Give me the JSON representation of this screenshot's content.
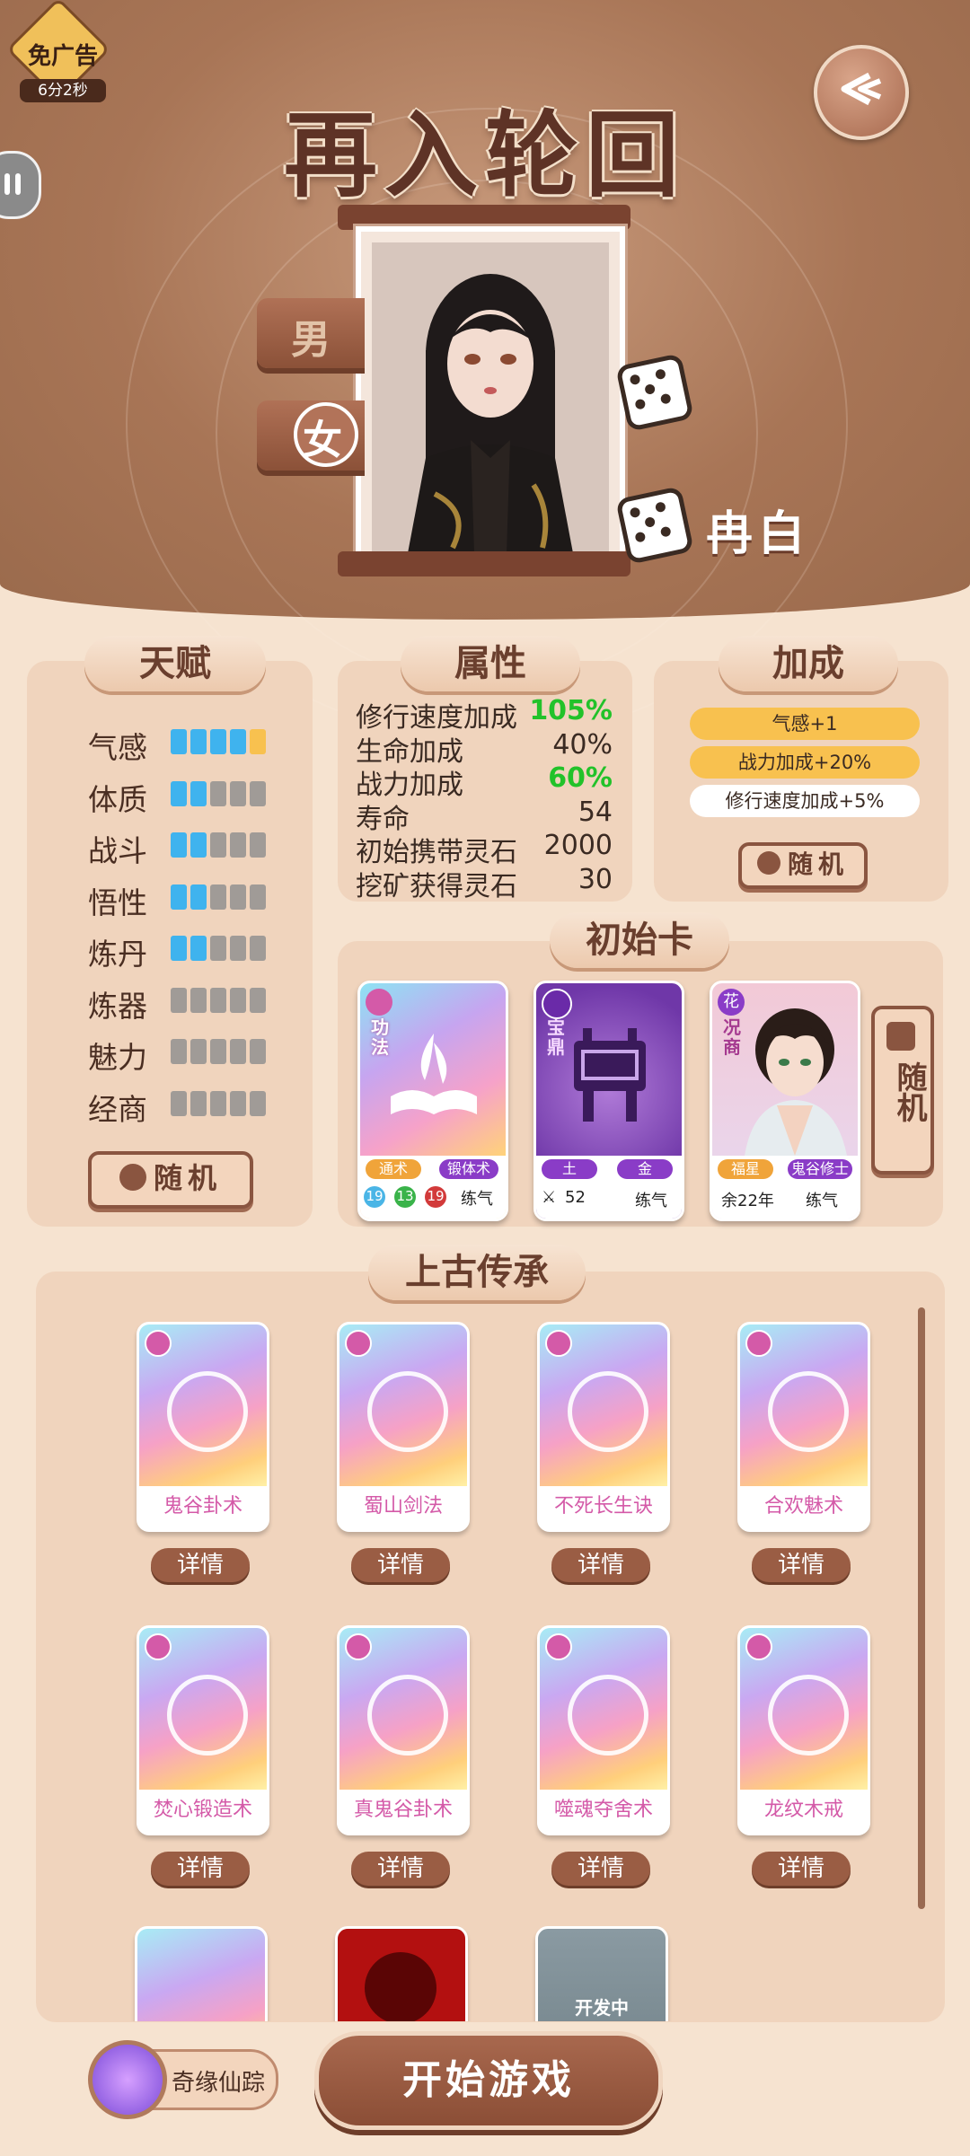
{
  "header": {
    "title": "再入轮回",
    "ad_label": "免广告",
    "ad_timer": "6分2秒"
  },
  "character": {
    "male": "男",
    "female": "女",
    "name": "冉白"
  },
  "talent": {
    "title": "天赋",
    "rows": [
      {
        "label": "气感",
        "level": 5
      },
      {
        "label": "体质",
        "level": 2
      },
      {
        "label": "战斗",
        "level": 2
      },
      {
        "label": "悟性",
        "level": 2
      },
      {
        "label": "炼丹",
        "level": 2
      },
      {
        "label": "炼器",
        "level": 0
      },
      {
        "label": "魅力",
        "level": 0
      },
      {
        "label": "经商",
        "level": 0
      }
    ],
    "random": "随机"
  },
  "attributes": {
    "title": "属性",
    "rows": [
      {
        "label": "修行速度加成",
        "value": "105%",
        "color": "#22c22a"
      },
      {
        "label": "生命加成",
        "value": "40%",
        "color": "#3a2a22"
      },
      {
        "label": "战力加成",
        "value": "60%",
        "color": "#22c22a"
      },
      {
        "label": "寿命",
        "value": "54",
        "color": "#3a2a22"
      },
      {
        "label": "初始携带灵石",
        "value": "2000",
        "color": "#3a2a22"
      },
      {
        "label": "挖矿获得灵石",
        "value": "30",
        "color": "#3a2a22"
      }
    ]
  },
  "bonus": {
    "title": "加成",
    "items": [
      {
        "text": "气感+1",
        "color": "#f8c14f"
      },
      {
        "text": "战力加成+20%",
        "color": "#f8c14f"
      },
      {
        "text": "修行速度加成+5%",
        "color": "#ffffff"
      }
    ],
    "random": "随机"
  },
  "initial_cards": {
    "title": "初始卡",
    "random": "随机",
    "cards": [
      {
        "category": "功法",
        "tag1": "通术",
        "tag2": "锻体术",
        "n1": "19",
        "n2": "13",
        "n3": "19",
        "stage": "练气"
      },
      {
        "category": "宝鼎",
        "tag1": "土",
        "tag2": "金",
        "power": "52",
        "stage": "练气"
      },
      {
        "category": "况商",
        "corner": "花",
        "tag1": "福星",
        "tag2": "鬼谷修士",
        "life": "余22年",
        "stage": "练气"
      }
    ]
  },
  "inheritance": {
    "title": "上古传承",
    "detail": "详情",
    "items": [
      "鬼谷卦术",
      "蜀山剑法",
      "不死长生诀",
      "合欢魅术",
      "焚心锻造术",
      "真鬼谷卦术",
      "噬魂夺舍术",
      "龙纹木戒"
    ],
    "dev_label": "开发中"
  },
  "footer": {
    "fate": "奇缘仙踪",
    "start": "开始游戏"
  }
}
